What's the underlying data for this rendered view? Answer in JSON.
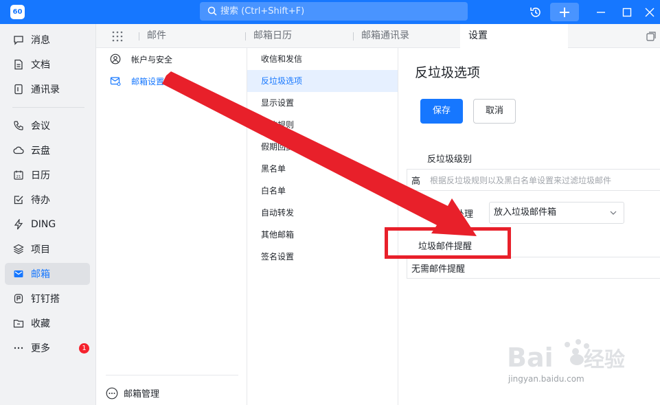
{
  "titlebar": {
    "logo": "60",
    "search_placeholder": "搜索 (Ctrl+Shift+F)",
    "color": "#1677ff"
  },
  "nav": {
    "items": [
      {
        "label": "消息",
        "icon": "chat-icon"
      },
      {
        "label": "文档",
        "icon": "document-icon"
      },
      {
        "label": "通讯录",
        "icon": "contacts-icon"
      },
      {
        "label": "会议",
        "icon": "phone-icon"
      },
      {
        "label": "云盘",
        "icon": "cloud-icon"
      },
      {
        "label": "日历",
        "icon": "calendar-icon"
      },
      {
        "label": "待办",
        "icon": "checklist-icon"
      },
      {
        "label": "DING",
        "icon": "lightning-icon"
      },
      {
        "label": "项目",
        "icon": "layers-icon"
      },
      {
        "label": "邮箱",
        "icon": "mail-icon",
        "active": true
      },
      {
        "label": "钉钉搭",
        "icon": "builder-icon"
      },
      {
        "label": "收藏",
        "icon": "folder-icon"
      },
      {
        "label": "更多",
        "icon": "more-icon",
        "badge": "1"
      }
    ]
  },
  "tabs": [
    {
      "label": "邮件"
    },
    {
      "label": "邮箱日历"
    },
    {
      "label": "邮箱通讯录"
    },
    {
      "label": "设置",
      "active": true
    }
  ],
  "settings_menu": {
    "items": [
      {
        "label": "帐户与安全",
        "icon": "user-circle-icon"
      },
      {
        "label": "邮箱设置",
        "icon": "mail-settings-icon",
        "active": true
      }
    ],
    "manage_label": "邮箱管理"
  },
  "submenu": {
    "items": [
      {
        "label": "收信和发信"
      },
      {
        "label": "反垃圾选项",
        "active": true
      },
      {
        "label": "显示设置"
      },
      {
        "label": "收信规则"
      },
      {
        "label": "假期回复设置"
      },
      {
        "label": "黑名单"
      },
      {
        "label": "白名单"
      },
      {
        "label": "自动转发"
      },
      {
        "label": "其他邮箱"
      },
      {
        "label": "签名设置"
      }
    ]
  },
  "content": {
    "title": "反垃圾选项",
    "save_label": "保存",
    "cancel_label": "取消",
    "level_label": "反垃圾级别",
    "level_value": "高",
    "level_hint": "根据反垃圾规则以及黑白名单设置来过滤垃圾邮件",
    "handling_label": "垃圾邮件处理",
    "handling_value": "放入垃圾邮件箱",
    "reminder_label": "垃圾邮件提醒",
    "reminder_value": "无需邮件提醒"
  },
  "annotation": {
    "color": "#e8202a"
  },
  "watermark": {
    "text": "jingyan.baidu.com",
    "brand": "Baidu经验"
  }
}
